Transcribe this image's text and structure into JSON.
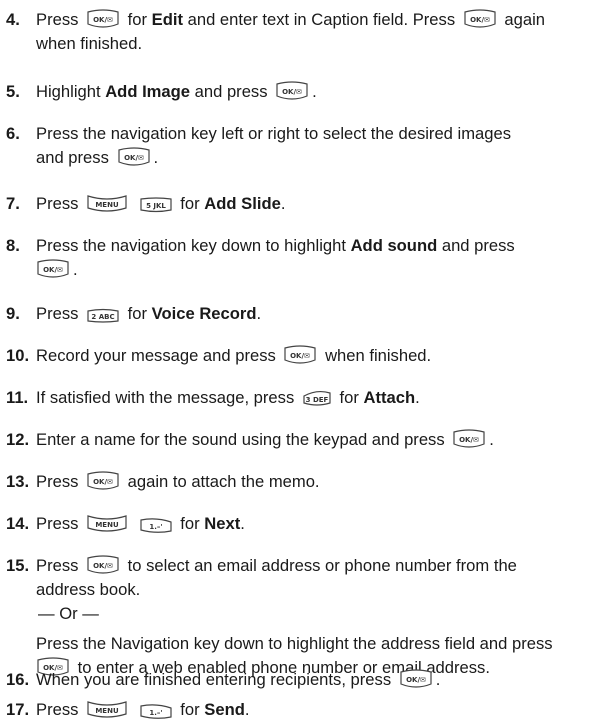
{
  "keys": {
    "ok": "OK/✉",
    "menu": "MENU",
    "k1": "1.–'",
    "k2": "2 ABC",
    "k3": "3 DEF",
    "k5": "5 JKL"
  },
  "steps": [
    {
      "num": "4.",
      "a": "Press",
      "b": "for",
      "c": "Edit",
      "d": "and enter text in Caption field. Press",
      "e": "again",
      "f": "when finished."
    },
    {
      "num": "5.",
      "a": "Highlight",
      "b": "Add Image",
      "c": "and press",
      "d": "."
    },
    {
      "num": "6.",
      "a": "Press the navigation key left or right to select the desired images",
      "b": "and press",
      "c": "."
    },
    {
      "num": "7.",
      "a": "Press",
      "b": "for",
      "c": "Add Slide",
      "d": "."
    },
    {
      "num": "8.",
      "a": "Press the navigation key down to highlight",
      "b": "Add sound",
      "c": "and press",
      "d": "."
    },
    {
      "num": "9.",
      "a": "Press",
      "b": "for",
      "c": "Voice Record",
      "d": "."
    },
    {
      "num": "10.",
      "a": "Record your message and press",
      "b": "when finished."
    },
    {
      "num": "11.",
      "a": "If satisfied with the message, press",
      "b": "for",
      "c": "Attach",
      "d": "."
    },
    {
      "num": "12.",
      "a": "Enter a name for the sound using the keypad and press",
      "b": "."
    },
    {
      "num": "13.",
      "a": "Press",
      "b": "again to attach the memo."
    },
    {
      "num": "14.",
      "a": "Press",
      "b": "for",
      "c": "Next",
      "d": "."
    },
    {
      "num": "15.",
      "a": "Press",
      "b": "to select an email address or phone number from the",
      "c": "address book.",
      "d": "— Or —",
      "e": "Press the Navigation key down to highlight the address field and press",
      "f": "to enter a web enabled phone number or email address."
    },
    {
      "num": "16.",
      "a": "When you are finished entering recipients, press",
      "b": "."
    },
    {
      "num": "17.",
      "a": "Press",
      "b": "for",
      "c": "Send",
      "d": "."
    }
  ]
}
